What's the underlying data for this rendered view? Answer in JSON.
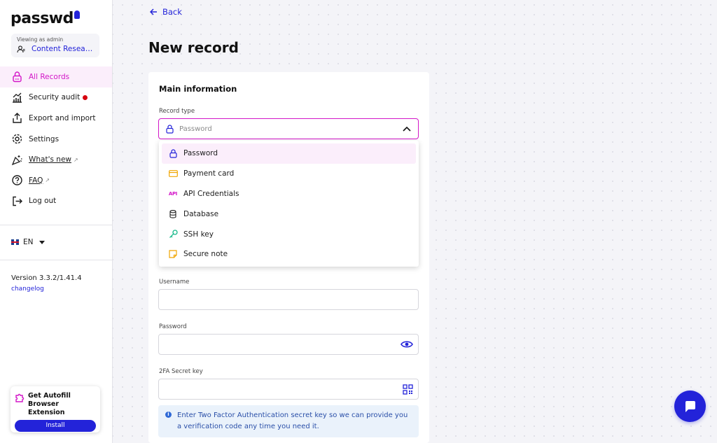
{
  "app": {
    "logo": "passwd"
  },
  "viewing": {
    "label": "Viewing as admin",
    "name": "Content Research"
  },
  "nav": [
    {
      "label": "All Records",
      "icon": "lock-icon",
      "active": true
    },
    {
      "label": "Security audit",
      "icon": "chart-icon",
      "badge": true
    },
    {
      "label": "Export and import",
      "icon": "upload-icon"
    },
    {
      "label": "Settings",
      "icon": "gear-icon"
    },
    {
      "label": "What's new",
      "icon": "sparkle-icon",
      "external": true
    },
    {
      "label": "FAQ",
      "icon": "question-icon",
      "external": true
    },
    {
      "label": "Log out",
      "icon": "logout-icon"
    }
  ],
  "language": {
    "code": "EN"
  },
  "version": {
    "text": "Version 3.3.2/1.41.4",
    "changelog": "changelog"
  },
  "autofill": {
    "title": "Get Autofill Browser Extension",
    "install": "Install"
  },
  "header": {
    "back": "Back",
    "title": "New record"
  },
  "form": {
    "section_title": "Main information",
    "record_type_label": "Record type",
    "record_type_placeholder": "Password",
    "username_label": "Username",
    "password_label": "Password",
    "secret_label": "2FA Secret key",
    "info_text": "Enter Two Factor Authentication secret key so we can provide you a verification code any time you need it."
  },
  "dropdown": {
    "options": [
      {
        "label": "Password",
        "icon": "lock-icon",
        "selected": true
      },
      {
        "label": "Payment card",
        "icon": "card-icon"
      },
      {
        "label": "API Credentials",
        "icon": "api-icon",
        "glyph": "API"
      },
      {
        "label": "Database",
        "icon": "database-icon"
      },
      {
        "label": "SSH key",
        "icon": "key-icon"
      },
      {
        "label": "Secure note",
        "icon": "note-icon"
      }
    ]
  },
  "colors": {
    "accent": "#2323d9",
    "active": "#d316c8",
    "active_bg": "#fbeefb"
  }
}
